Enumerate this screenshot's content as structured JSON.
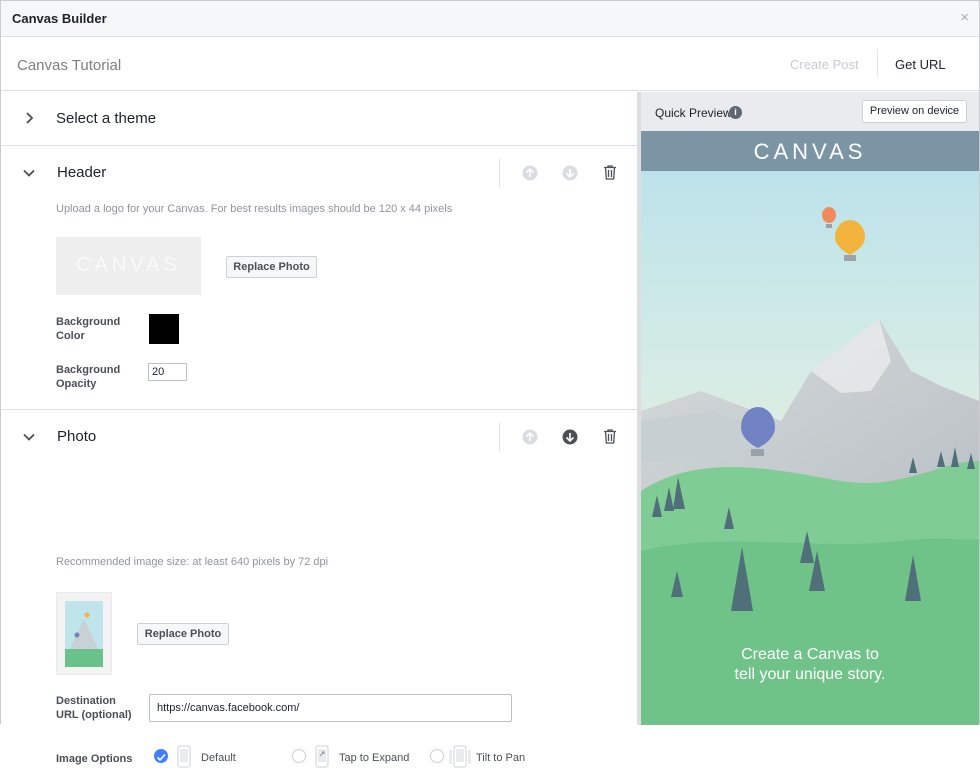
{
  "window": {
    "title": "Canvas Builder",
    "close_glyph": "×"
  },
  "docbar": {
    "name": "Canvas Tutorial",
    "create_post": "Create Post",
    "get_url": "Get URL"
  },
  "theme_section": {
    "title": "Select a theme"
  },
  "header_section": {
    "title": "Header",
    "hint": "Upload a logo for your Canvas. For best results images should be 120 x 44 pixels",
    "logo_text": "CANVAS",
    "replace_photo": "Replace Photo",
    "bg_color_label_1": "Background",
    "bg_color_label_2": "Color",
    "bg_color": "#000000",
    "bg_opacity_label_1": "Background",
    "bg_opacity_label_2": "Opacity",
    "bg_opacity_value": "20"
  },
  "photo_section": {
    "title": "Photo",
    "hint": "Recommended image size: at least 640 pixels by 72 dpi",
    "replace_photo": "Replace Photo",
    "dest_label_1": "Destination",
    "dest_label_2": "URL (optional)",
    "dest_value": "https://canvas.facebook.com/",
    "image_options_label": "Image Options",
    "options": [
      {
        "label": "Default",
        "selected": true
      },
      {
        "label": "Tap to Expand",
        "selected": false
      },
      {
        "label": "Tilt to Pan",
        "selected": false
      }
    ]
  },
  "preview": {
    "label": "Quick Preview",
    "info_glyph": "i",
    "device_button": "Preview on device",
    "canvas_title": "CANVAS",
    "tagline_1": "Create a Canvas to",
    "tagline_2": "tell your unique story."
  },
  "icons": [
    "chevron-right-icon",
    "chevron-down-icon",
    "arrow-up-icon",
    "arrow-down-icon",
    "trash-icon",
    "info-icon",
    "phone-icon",
    "check-icon"
  ],
  "colors": {
    "accent": "#4080ff",
    "preview_header": "#7c95a5",
    "grass": "#6fc389"
  }
}
